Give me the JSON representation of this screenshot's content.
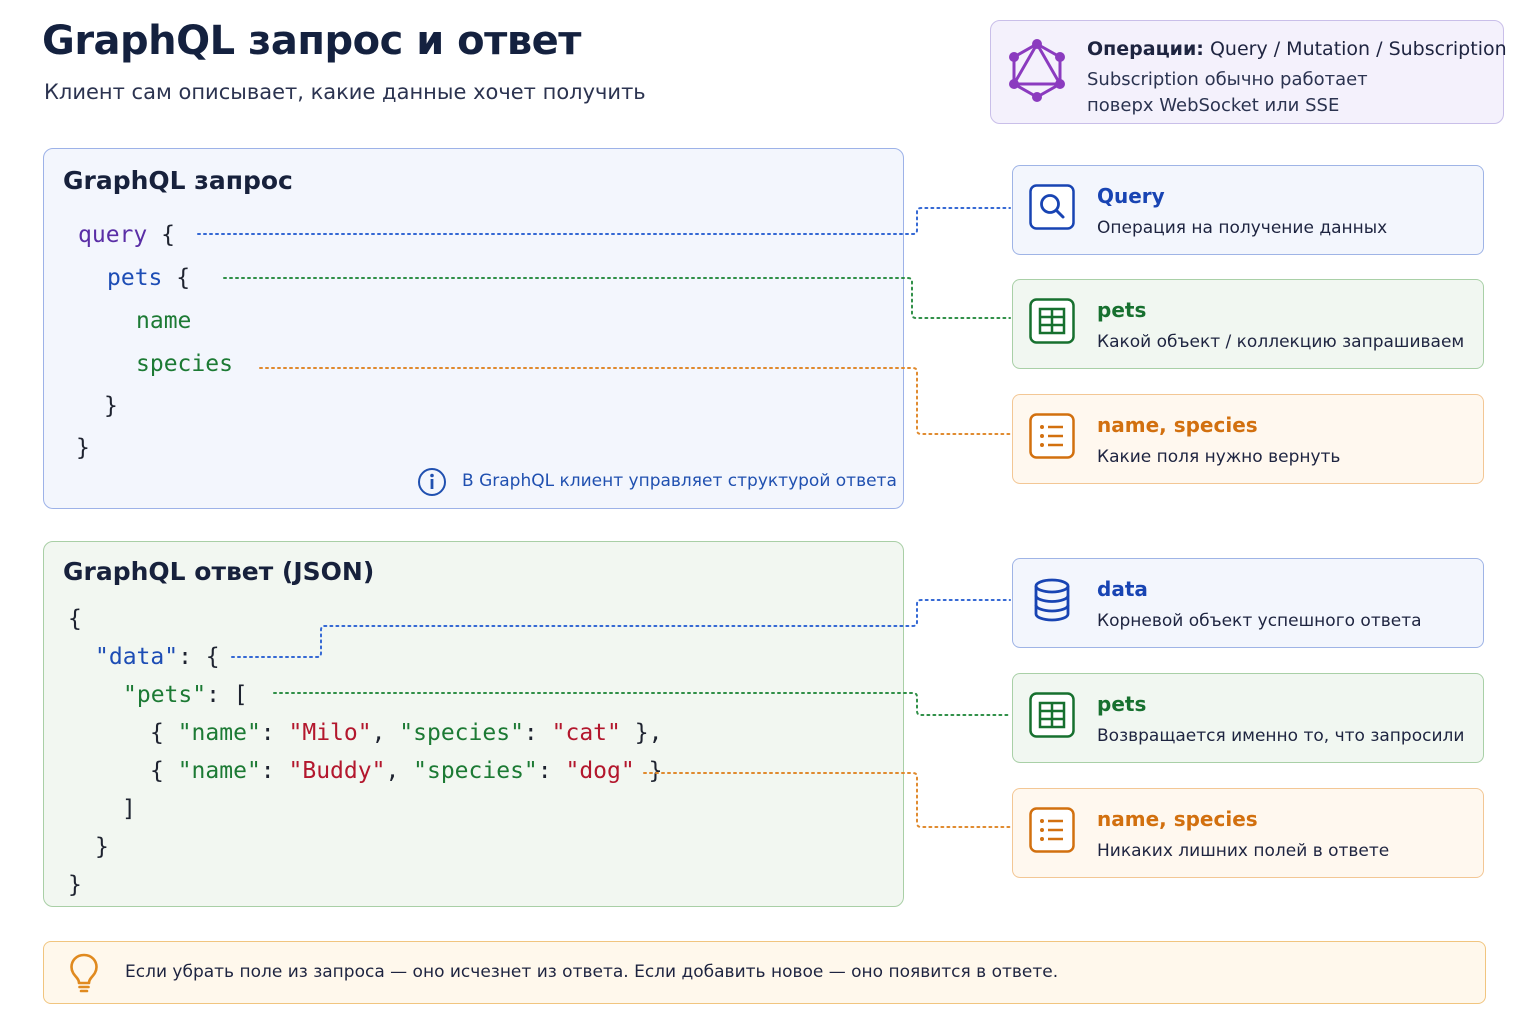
{
  "header": {
    "title": "GraphQL запрос и ответ",
    "subtitle": "Клиент сам описывает, какие данные хочет получить"
  },
  "operations": {
    "label": "Операции:",
    "list": "Query / Mutation / Subscription",
    "note_line1": "Subscription обычно работает",
    "note_line2": "поверх WebSocket или SSE",
    "icon": "graphql-logo-icon"
  },
  "query_panel": {
    "title": "GraphQL запрос",
    "code": {
      "l1_kw": "query",
      "l1_brace": "{",
      "l2_field": "pets",
      "l2_brace": "{",
      "l3_field": "name",
      "l4_field": "species",
      "l5": "}",
      "l6": "}"
    },
    "note": "В GraphQL клиент управляет структурой ответа"
  },
  "response_panel": {
    "title": "GraphQL ответ (JSON)",
    "code": {
      "open": "{",
      "data_key": "\"data\"",
      "data_sep": ": {",
      "pets_key": "\"pets\"",
      "pets_sep": ": [",
      "row1": {
        "open": "{ ",
        "k1": "\"name\"",
        "c1": ": ",
        "v1": "\"Milo\"",
        "sep": ", ",
        "k2": "\"species\"",
        "c2": ": ",
        "v2": "\"cat\"",
        "close": " },"
      },
      "row2": {
        "open": "{ ",
        "k1": "\"name\"",
        "c1": ": ",
        "v1": "\"Buddy\"",
        "sep": ", ",
        "k2": "\"species\"",
        "c2": ": ",
        "v2": "\"dog\"",
        "close": " }"
      },
      "close_arr": "]",
      "close_data": "}",
      "close_root": "}"
    }
  },
  "query_cards": [
    {
      "title": "Query",
      "desc": "Операция на получение данных",
      "icon": "search-icon",
      "color": "#1844b3"
    },
    {
      "title": "pets",
      "desc": "Какой объект / коллекцию запрашиваем",
      "icon": "table-icon",
      "color": "#17702f"
    },
    {
      "title": "name, species",
      "desc": "Какие поля нужно вернуть",
      "icon": "list-icon",
      "color": "#d2700f"
    }
  ],
  "response_cards": [
    {
      "title": "data",
      "desc": "Корневой объект успешного ответа",
      "icon": "database-icon",
      "color": "#1844b3"
    },
    {
      "title": "pets",
      "desc": "Возвращается именно то, что запросили",
      "icon": "table-icon",
      "color": "#17702f"
    },
    {
      "title": "name, species",
      "desc": "Никаких лишних полей в ответе",
      "icon": "list-icon",
      "color": "#d2700f"
    }
  ],
  "tip": {
    "text": "Если убрать поле из запроса — оно исчезнет из ответа. Если добавить новое — оно появится в ответе.",
    "icon": "lightbulb-icon"
  }
}
